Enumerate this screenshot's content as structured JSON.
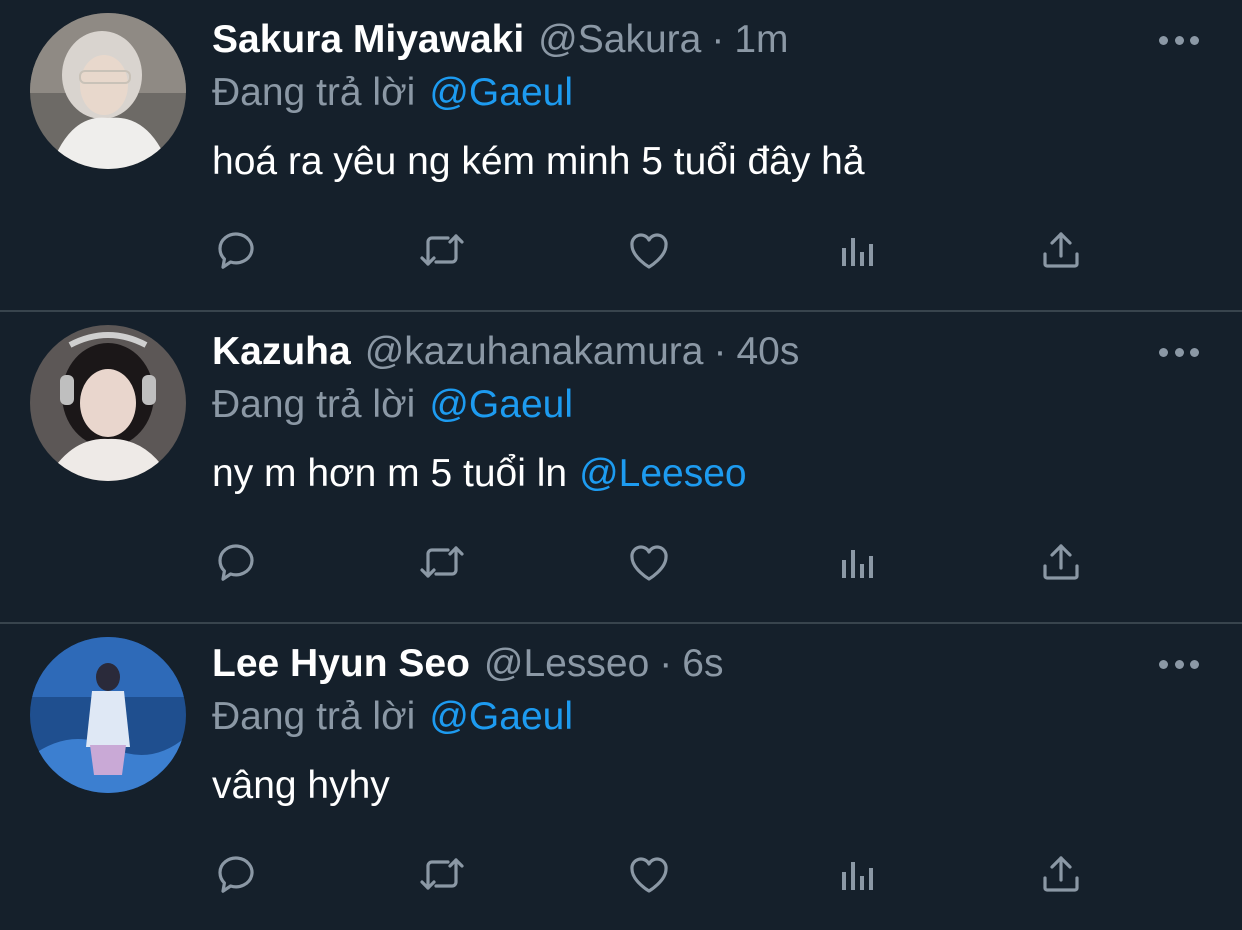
{
  "tweets": [
    {
      "name": "Sakura Miyawaki",
      "handle": "@Sakura",
      "dot": "·",
      "time": "1m",
      "reply_prefix": "Đang trả lời",
      "reply_to": "@Gaeul",
      "text": "hoá ra yêu ng kém minh 5 tuổi đây hả",
      "text_mention": ""
    },
    {
      "name": "Kazuha",
      "handle": "@kazuhanakamura",
      "dot": "·",
      "time": "40s",
      "reply_prefix": "Đang trả lời",
      "reply_to": "@Gaeul",
      "text": "ny m hơn m 5 tuổi ln",
      "text_mention": "@Leeseo"
    },
    {
      "name": "Lee Hyun Seo",
      "handle": "@Lesseo",
      "dot": "·",
      "time": "6s",
      "reply_prefix": "Đang trả lời",
      "reply_to": "@Gaeul",
      "text": "vâng hyhy",
      "text_mention": ""
    }
  ],
  "icons": {
    "reply": "reply-icon",
    "retweet": "retweet-icon",
    "like": "like-icon",
    "views": "views-icon",
    "share": "share-icon",
    "more": "more-icon"
  },
  "colors": {
    "background": "#15202b",
    "secondary_text": "#8b98a5",
    "mention": "#1d9bf0",
    "divider": "#38444d"
  }
}
